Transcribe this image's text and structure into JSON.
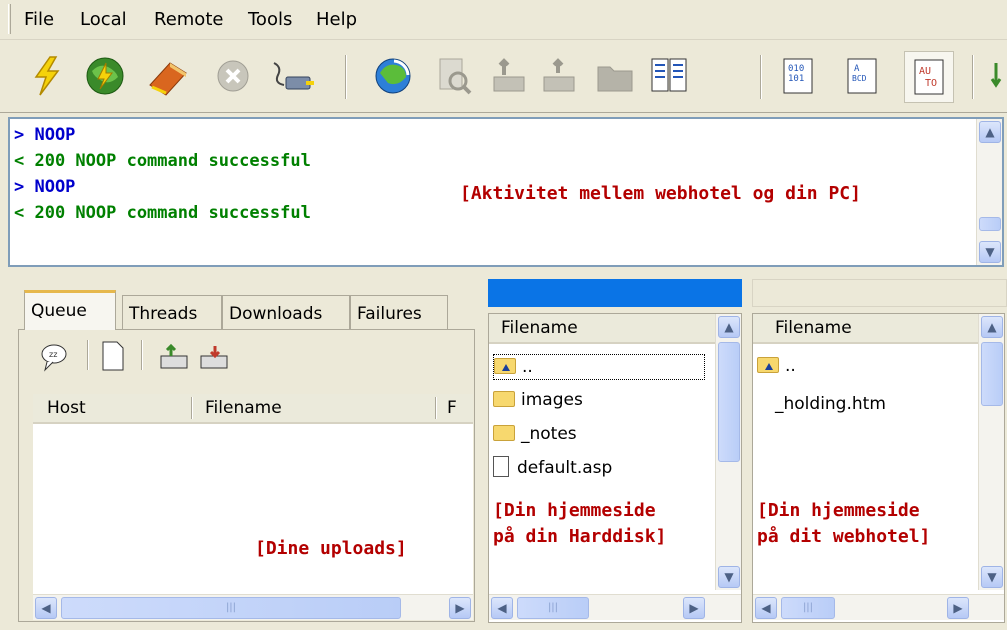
{
  "menu": [
    "File",
    "Local",
    "Remote",
    "Tools",
    "Help"
  ],
  "toolbar": {
    "icons": [
      "connect-icon",
      "quick-connect-icon",
      "site-manager-icon",
      "disconnect-icon",
      "reconnect-icon",
      "refresh-icon",
      "view-file-icon",
      "upload-icon",
      "download-icon",
      "new-folder-icon",
      "compare-icon",
      "binary-mode-icon",
      "ascii-mode-icon",
      "auto-mode-icon"
    ]
  },
  "log": {
    "lines": [
      {
        "text": "> NOOP",
        "color": "#0000cc"
      },
      {
        "text": "< 200 NOOP command successful",
        "color": "#008000"
      },
      {
        "text": "> NOOP",
        "color": "#0000cc"
      },
      {
        "text": "< 200 NOOP command successful",
        "color": "#008000"
      }
    ],
    "annotation": "[Aktivitet mellem webhotel og din PC]"
  },
  "queue": {
    "tabs": [
      "Queue",
      "Threads",
      "Downloads",
      "Failures"
    ],
    "active_tab": "Queue",
    "columns": [
      "Host",
      "Filename",
      "F"
    ],
    "annotation": "[Dine uploads]"
  },
  "local": {
    "column": "Filename",
    "files": [
      {
        "name": "..",
        "type": "up-folder"
      },
      {
        "name": "images",
        "type": "folder"
      },
      {
        "name": "_notes",
        "type": "folder"
      },
      {
        "name": "default.asp",
        "type": "file"
      }
    ],
    "annotation_line1": "[Din hjemmeside",
    "annotation_line2": "på din Harddisk]"
  },
  "remote": {
    "column": "Filename",
    "files": [
      {
        "name": "..",
        "type": "up-folder"
      },
      {
        "name": "_holding.htm",
        "type": "file"
      }
    ],
    "annotation_line1": "[Din hjemmeside",
    "annotation_line2": "på dit webhotel]"
  },
  "colors": {
    "path_bar": "#0a74e6",
    "annotation": "#b30000"
  }
}
